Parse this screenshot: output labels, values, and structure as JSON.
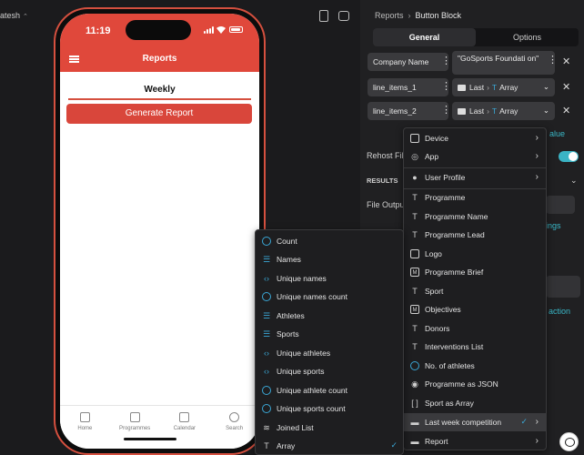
{
  "workspace": {
    "user_name": "atesh",
    "caret": "⌃"
  },
  "phone": {
    "time": "11:19",
    "header_title": "Reports",
    "weekly_label": "Weekly",
    "generate_button": "Generate Report",
    "tabs": [
      {
        "label": "Home",
        "icon": "home-icon"
      },
      {
        "label": "Programmes",
        "icon": "chat-icon"
      },
      {
        "label": "Calendar",
        "icon": "calendar-icon"
      },
      {
        "label": "Search",
        "icon": "search-icon"
      }
    ]
  },
  "panel": {
    "breadcrumb": {
      "root": "Reports",
      "separator": "›",
      "current": "Button Block"
    },
    "tabs": {
      "general": "General",
      "options": "Options"
    },
    "rows": [
      {
        "key": "Company Name",
        "value": "\"GoSports Foundati on\""
      },
      {
        "key": "line_items_1",
        "value_prefix": "Last",
        "value": "Array"
      },
      {
        "key": "line_items_2",
        "value_prefix": "Last",
        "value": "Array"
      }
    ],
    "background": {
      "rehost_label": "Rehost Fil",
      "results_label": "RESULTS",
      "file_output_label": "File Outpu",
      "value_link": "alue",
      "settings_link": "ings",
      "action_link": "action"
    }
  },
  "menu_right": {
    "items": [
      {
        "label": "Device",
        "icon": "device-icon",
        "chevron": true
      },
      {
        "label": "App",
        "icon": "app-icon",
        "chevron": true
      },
      {
        "label": "User Profile",
        "icon": "user-icon",
        "chevron": true
      },
      {
        "label": "Programme",
        "icon": "text-icon"
      },
      {
        "label": "Programme Name",
        "icon": "text-icon"
      },
      {
        "label": "Programme Lead",
        "icon": "text-icon"
      },
      {
        "label": "Logo",
        "icon": "image-icon"
      },
      {
        "label": "Programme Brief",
        "icon": "rich-text-icon"
      },
      {
        "label": "Sport",
        "icon": "text-icon"
      },
      {
        "label": "Objectives",
        "icon": "rich-text-icon"
      },
      {
        "label": "Donors",
        "icon": "text-icon"
      },
      {
        "label": "Interventions List",
        "icon": "text-icon"
      },
      {
        "label": "No. of athletes",
        "icon": "count-icon"
      },
      {
        "label": "Programme as JSON",
        "icon": "json-icon"
      },
      {
        "label": "Sport as Array",
        "icon": "array-icon"
      },
      {
        "label": "Last week competition",
        "icon": "folder-icon",
        "chevron": true,
        "checked": true
      },
      {
        "label": "Report",
        "icon": "folder-icon",
        "chevron": true
      }
    ]
  },
  "menu_left": {
    "items": [
      {
        "label": "Count",
        "icon": "count-icon"
      },
      {
        "label": "Names",
        "icon": "names-icon"
      },
      {
        "label": "Unique names",
        "icon": "code-icon"
      },
      {
        "label": "Unique names count",
        "icon": "count-icon"
      },
      {
        "label": "Athletes",
        "icon": "names-icon"
      },
      {
        "label": "Sports",
        "icon": "names-icon"
      },
      {
        "label": "Unique athletes",
        "icon": "code-icon"
      },
      {
        "label": "Unique sports",
        "icon": "code-icon"
      },
      {
        "label": "Unique athlete count",
        "icon": "count-icon"
      },
      {
        "label": "Unique sports count",
        "icon": "count-icon"
      },
      {
        "label": "Joined List",
        "icon": "join-icon"
      },
      {
        "label": "Array",
        "icon": "text-array-icon",
        "checked": true
      }
    ]
  },
  "colors": {
    "accent_red": "#e0483b",
    "accent_teal": "#3ab3c4",
    "check_blue": "#3aa7d6"
  }
}
